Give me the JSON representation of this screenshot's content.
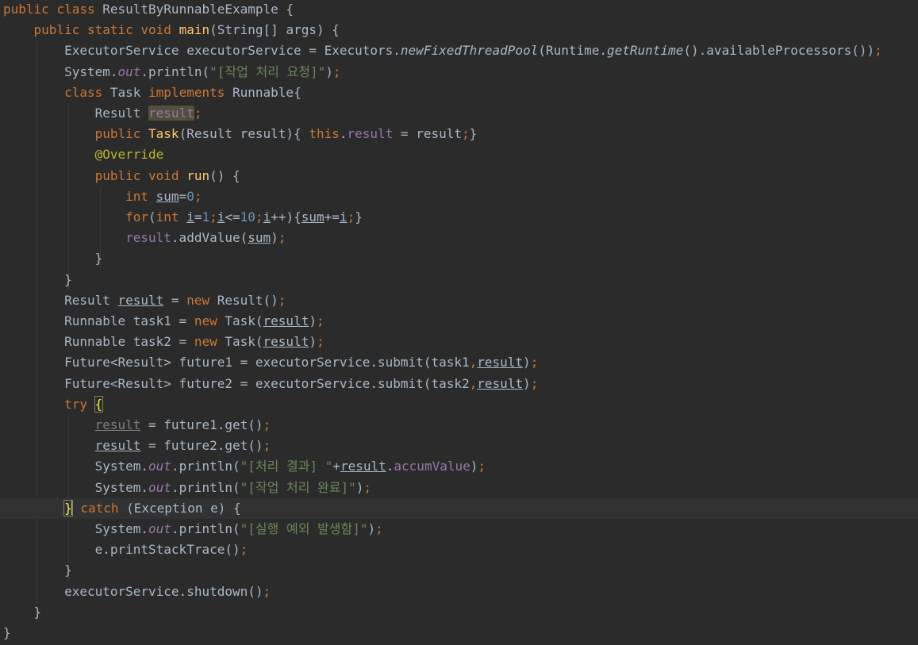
{
  "editor": {
    "current_line": 24,
    "lines": [
      [
        [
          "kw",
          "public "
        ],
        [
          "kw",
          "class "
        ],
        [
          "p",
          "ResultByRunnableExample {"
        ]
      ],
      [
        [
          "p",
          "    "
        ],
        [
          "kw",
          "public "
        ],
        [
          "kw",
          "static "
        ],
        [
          "kw",
          "void "
        ],
        [
          "fn",
          "main"
        ],
        [
          "p",
          "(String[] args) {"
        ]
      ],
      [
        [
          "p",
          "        ExecutorService executorService = Executors."
        ],
        [
          "sm",
          "newFixedThreadPool"
        ],
        [
          "p",
          "(Runtime."
        ],
        [
          "sm",
          "getRuntime"
        ],
        [
          "p",
          "().availableProcessors())"
        ],
        [
          "kw",
          ";"
        ]
      ],
      [
        [
          "p",
          "        System."
        ],
        [
          "st",
          "out"
        ],
        [
          "p",
          ".println("
        ],
        [
          "str",
          "\"[작업 처리 요청]\""
        ],
        [
          "p",
          ")"
        ],
        [
          "kw",
          ";"
        ]
      ],
      [
        [
          "p",
          "        "
        ],
        [
          "kw",
          "class "
        ],
        [
          "p",
          "Task "
        ],
        [
          "kw",
          "implements "
        ],
        [
          "p",
          "Runnable{"
        ]
      ],
      [
        [
          "p",
          "            Result "
        ],
        [
          "fhl",
          "result"
        ],
        [
          "kw",
          ";"
        ]
      ],
      [
        [
          "p",
          "            "
        ],
        [
          "kw",
          "public "
        ],
        [
          "fn",
          "Task"
        ],
        [
          "p",
          "(Result result){ "
        ],
        [
          "kw",
          "this"
        ],
        [
          "p",
          "."
        ],
        [
          "f",
          "result"
        ],
        [
          "p",
          " = result"
        ],
        [
          "kw",
          ";"
        ],
        [
          "p",
          "}"
        ]
      ],
      [
        [
          "p",
          "            "
        ],
        [
          "ann",
          "@Override"
        ]
      ],
      [
        [
          "p",
          "            "
        ],
        [
          "kw",
          "public "
        ],
        [
          "kw",
          "void "
        ],
        [
          "fn",
          "run"
        ],
        [
          "p",
          "() {"
        ]
      ],
      [
        [
          "p",
          "                "
        ],
        [
          "kw",
          "int "
        ],
        [
          "ul",
          "sum"
        ],
        [
          "p",
          "="
        ],
        [
          "num",
          "0"
        ],
        [
          "kw",
          ";"
        ]
      ],
      [
        [
          "p",
          "                "
        ],
        [
          "kw",
          "for"
        ],
        [
          "p",
          "("
        ],
        [
          "kw",
          "int "
        ],
        [
          "ul",
          "i"
        ],
        [
          "p",
          "="
        ],
        [
          "num",
          "1"
        ],
        [
          "kw",
          ";"
        ],
        [
          "ul",
          "i"
        ],
        [
          "p",
          "<="
        ],
        [
          "num",
          "10"
        ],
        [
          "kw",
          ";"
        ],
        [
          "ul",
          "i"
        ],
        [
          "p",
          "++){"
        ],
        [
          "ul",
          "sum"
        ],
        [
          "p",
          "+="
        ],
        [
          "ul",
          "i"
        ],
        [
          "kw",
          ";"
        ],
        [
          "p",
          "}"
        ]
      ],
      [
        [
          "p",
          "                "
        ],
        [
          "f",
          "result"
        ],
        [
          "p",
          ".addValue("
        ],
        [
          "ul",
          "sum"
        ],
        [
          "p",
          ")"
        ],
        [
          "kw",
          ";"
        ]
      ],
      [
        [
          "p",
          "            }"
        ]
      ],
      [
        [
          "p",
          "        }"
        ]
      ],
      [
        [
          "p",
          "        Result "
        ],
        [
          "ul",
          "result"
        ],
        [
          "p",
          " = "
        ],
        [
          "kw",
          "new "
        ],
        [
          "p",
          "Result()"
        ],
        [
          "kw",
          ";"
        ]
      ],
      [
        [
          "p",
          "        Runnable task1 = "
        ],
        [
          "kw",
          "new "
        ],
        [
          "p",
          "Task("
        ],
        [
          "ul",
          "result"
        ],
        [
          "p",
          ")"
        ],
        [
          "kw",
          ";"
        ]
      ],
      [
        [
          "p",
          "        Runnable task2 = "
        ],
        [
          "kw",
          "new "
        ],
        [
          "p",
          "Task("
        ],
        [
          "ul",
          "result"
        ],
        [
          "p",
          ")"
        ],
        [
          "kw",
          ";"
        ]
      ],
      [
        [
          "p",
          "        Future<Result> future1 = executorService.submit(task1"
        ],
        [
          "kw",
          ","
        ],
        [
          "ul",
          "result"
        ],
        [
          "p",
          ")"
        ],
        [
          "kw",
          ";"
        ]
      ],
      [
        [
          "p",
          "        Future<Result> future2 = executorService.submit(task2"
        ],
        [
          "kw",
          ","
        ],
        [
          "ul",
          "result"
        ],
        [
          "p",
          ")"
        ],
        [
          "kw",
          ";"
        ]
      ],
      [
        [
          "p",
          "        "
        ],
        [
          "kw",
          "try "
        ],
        [
          "br",
          "{"
        ]
      ],
      [
        [
          "p",
          "            "
        ],
        [
          "uu",
          "result"
        ],
        [
          "p",
          " = future1.get()"
        ],
        [
          "kw",
          ";"
        ]
      ],
      [
        [
          "p",
          "            "
        ],
        [
          "ul",
          "result"
        ],
        [
          "p",
          " = future2.get()"
        ],
        [
          "kw",
          ";"
        ]
      ],
      [
        [
          "p",
          "            System."
        ],
        [
          "st",
          "out"
        ],
        [
          "p",
          ".println("
        ],
        [
          "str",
          "\"[처리 결과] \""
        ],
        [
          "p",
          "+"
        ],
        [
          "ul",
          "result"
        ],
        [
          "p",
          "."
        ],
        [
          "f",
          "accumValue"
        ],
        [
          "p",
          ")"
        ],
        [
          "kw",
          ";"
        ]
      ],
      [
        [
          "p",
          "            System."
        ],
        [
          "st",
          "out"
        ],
        [
          "p",
          ".println("
        ],
        [
          "str",
          "\"[작업 처리 완료]\""
        ],
        [
          "p",
          ")"
        ],
        [
          "kw",
          ";"
        ]
      ],
      [
        [
          "p",
          "        "
        ],
        [
          "brc",
          "}"
        ],
        [
          "p",
          " "
        ],
        [
          "kw",
          "catch "
        ],
        [
          "p",
          "(Exception e) {"
        ]
      ],
      [
        [
          "p",
          "            System."
        ],
        [
          "st",
          "out"
        ],
        [
          "p",
          ".println("
        ],
        [
          "str",
          "\"[실행 예외 발생함]\""
        ],
        [
          "p",
          ")"
        ],
        [
          "kw",
          ";"
        ]
      ],
      [
        [
          "p",
          "            e.printStackTrace()"
        ],
        [
          "kw",
          ";"
        ]
      ],
      [
        [
          "p",
          "        }"
        ]
      ],
      [
        [
          "p",
          "        executorService.shutdown()"
        ],
        [
          "kw",
          ";"
        ]
      ],
      [
        [
          "p",
          "    }"
        ]
      ],
      [
        [
          "p",
          "}"
        ]
      ]
    ]
  }
}
